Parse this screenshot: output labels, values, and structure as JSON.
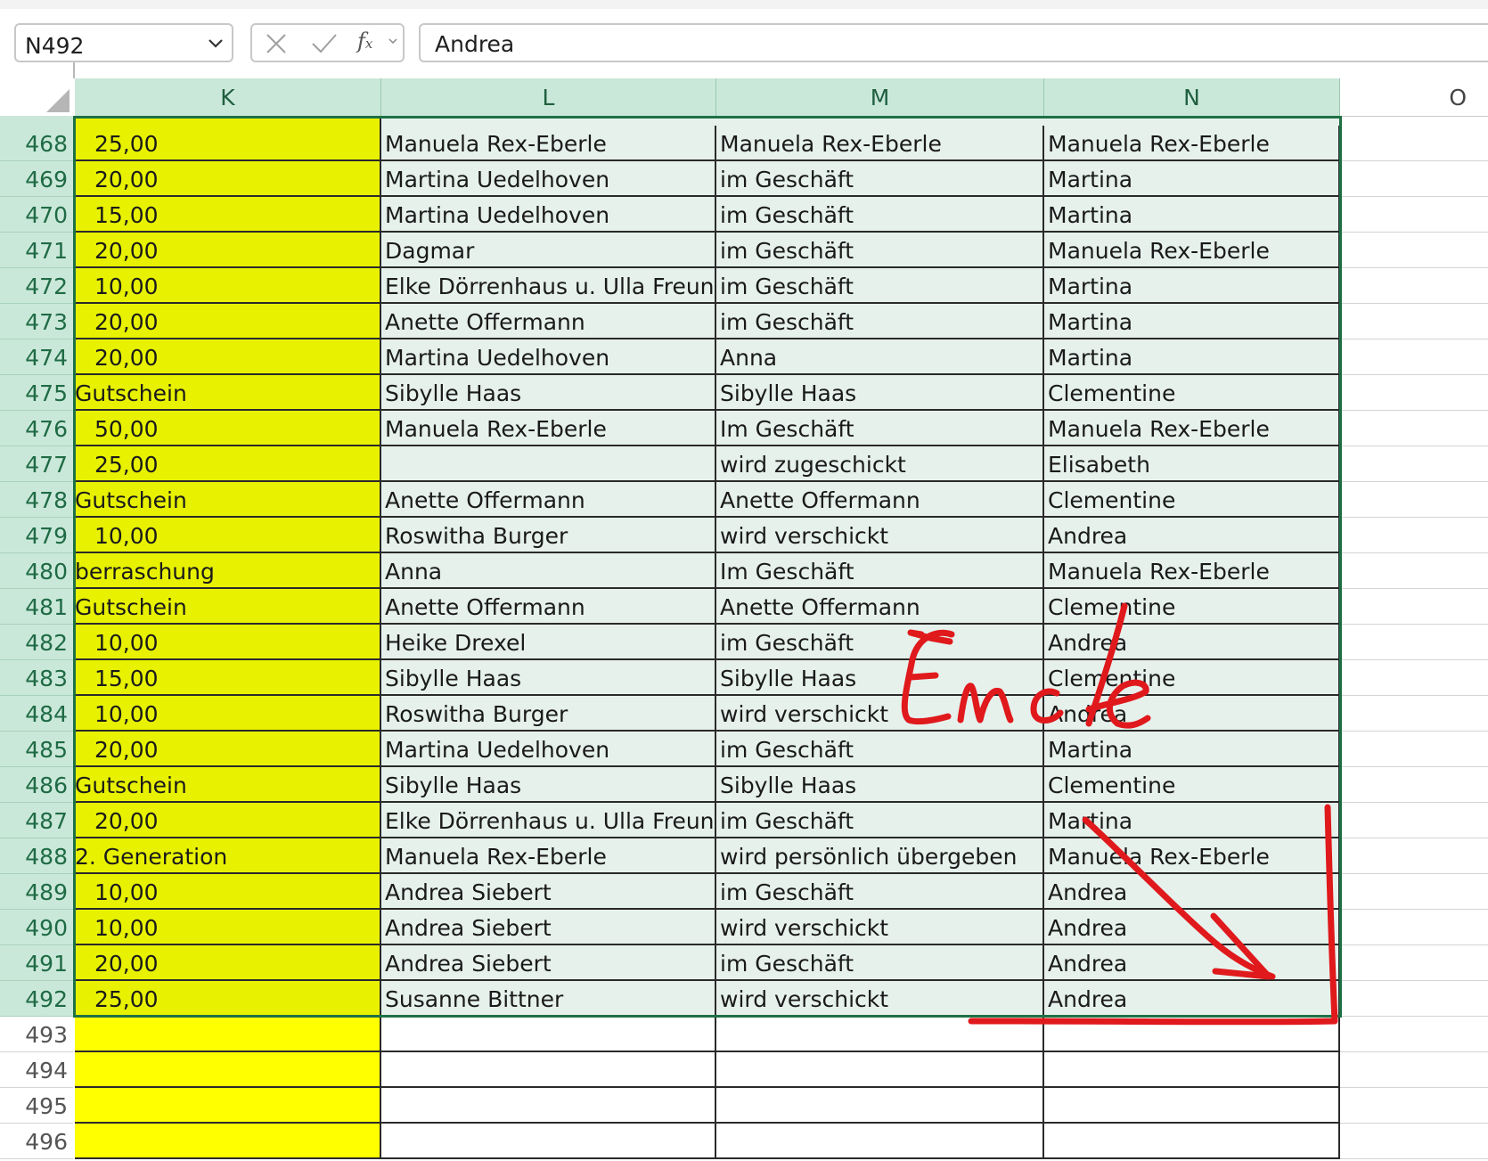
{
  "formula_bar": {
    "name_box": "N492",
    "formula_value": "Andrea",
    "fx_label": "f",
    "fx_sub": "x"
  },
  "columns": [
    {
      "letter": "K",
      "selected": true
    },
    {
      "letter": "L",
      "selected": true
    },
    {
      "letter": "M",
      "selected": true
    },
    {
      "letter": "N",
      "selected": true
    },
    {
      "letter": "O",
      "selected": false
    }
  ],
  "rows": [
    {
      "num": "468",
      "k": "25,00",
      "k_type": "num",
      "l": "Manuela Rex-Eberle",
      "m": "Manuela Rex-Eberle",
      "n": "Manuela Rex-Eberle"
    },
    {
      "num": "469",
      "k": "20,00",
      "k_type": "num",
      "l": "Martina Uedelhoven",
      "m": "im Geschäft",
      "n": "Martina"
    },
    {
      "num": "470",
      "k": "15,00",
      "k_type": "num",
      "l": "Martina Uedelhoven",
      "m": "im Geschäft",
      "n": "Martina"
    },
    {
      "num": "471",
      "k": "20,00",
      "k_type": "num",
      "l": "Dagmar",
      "m": "im Geschäft",
      "n": "Manuela Rex-Eberle"
    },
    {
      "num": "472",
      "k": "10,00",
      "k_type": "num",
      "l": "Elke Dörrenhaus u. Ulla Freund",
      "m": "im Geschäft",
      "n": "Martina"
    },
    {
      "num": "473",
      "k": "20,00",
      "k_type": "num",
      "l": "Anette Offermann",
      "m": "im Geschäft",
      "n": "Martina"
    },
    {
      "num": "474",
      "k": "20,00",
      "k_type": "num",
      "l": "Martina Uedelhoven",
      "m": "Anna",
      "n": "Martina"
    },
    {
      "num": "475",
      "k": "Gutschein",
      "k_type": "txt",
      "l": "Sibylle Haas",
      "m": "Sibylle Haas",
      "n": "Clementine"
    },
    {
      "num": "476",
      "k": "50,00",
      "k_type": "num",
      "l": "Manuela Rex-Eberle",
      "m": "Im Geschäft",
      "n": "Manuela Rex-Eberle"
    },
    {
      "num": "477",
      "k": "25,00",
      "k_type": "num",
      "l": "",
      "m": "wird zugeschickt",
      "n": "Elisabeth"
    },
    {
      "num": "478",
      "k": "Gutschein",
      "k_type": "txt",
      "l": "Anette Offermann",
      "m": "Anette Offermann",
      "n": "Clementine"
    },
    {
      "num": "479",
      "k": "10,00",
      "k_type": "num",
      "l": "Roswitha Burger",
      "m": "wird verschickt",
      "n": "Andrea"
    },
    {
      "num": "480",
      "k": "berraschung",
      "k_type": "txt",
      "l": "Anna",
      "m": "Im Geschäft",
      "n": "Manuela Rex-Eberle"
    },
    {
      "num": "481",
      "k": "Gutschein",
      "k_type": "txt",
      "l": "Anette Offermann",
      "m": "Anette Offermann",
      "n": "Clementine"
    },
    {
      "num": "482",
      "k": "10,00",
      "k_type": "num",
      "l": "Heike Drexel",
      "m": "im Geschäft",
      "n": "Andrea"
    },
    {
      "num": "483",
      "k": "15,00",
      "k_type": "num",
      "l": "Sibylle Haas",
      "m": "Sibylle Haas",
      "n": "Clementine"
    },
    {
      "num": "484",
      "k": "10,00",
      "k_type": "num",
      "l": "Roswitha Burger",
      "m": "wird verschickt",
      "n": "Andrea"
    },
    {
      "num": "485",
      "k": "20,00",
      "k_type": "num",
      "l": "Martina Uedelhoven",
      "m": "im Geschäft",
      "n": "Martina"
    },
    {
      "num": "486",
      "k": "Gutschein",
      "k_type": "txt",
      "l": "Sibylle Haas",
      "m": "Sibylle Haas",
      "n": "Clementine"
    },
    {
      "num": "487",
      "k": "20,00",
      "k_type": "num",
      "l": "Elke Dörrenhaus u. Ulla Freund",
      "m": "im Geschäft",
      "n": "Martina"
    },
    {
      "num": "488",
      "k": "2. Generation",
      "k_type": "txt",
      "l": "Manuela Rex-Eberle",
      "m": "wird persönlich übergeben",
      "n": "Manuela Rex-Eberle"
    },
    {
      "num": "489",
      "k": "10,00",
      "k_type": "num",
      "l": "Andrea Siebert",
      "m": "im Geschäft",
      "n": "Andrea"
    },
    {
      "num": "490",
      "k": "10,00",
      "k_type": "num",
      "l": "Andrea Siebert",
      "m": "wird verschickt",
      "n": "Andrea"
    },
    {
      "num": "491",
      "k": "20,00",
      "k_type": "num",
      "l": "Andrea Siebert",
      "m": "im Geschäft",
      "n": "Andrea"
    },
    {
      "num": "492",
      "k": "25,00",
      "k_type": "num",
      "l": "Susanne Bittner",
      "m": "wird verschickt",
      "n": "Andrea"
    },
    {
      "num": "493",
      "k": "",
      "k_type": "num",
      "l": "",
      "m": "",
      "n": ""
    },
    {
      "num": "494",
      "k": "",
      "k_type": "num",
      "l": "",
      "m": "",
      "n": ""
    },
    {
      "num": "495",
      "k": "",
      "k_type": "num",
      "l": "",
      "m": "",
      "n": ""
    },
    {
      "num": "496",
      "k": "",
      "k_type": "num",
      "l": "",
      "m": "",
      "n": ""
    }
  ],
  "selection": {
    "first_row": "468",
    "last_row": "492",
    "first_col": "K",
    "last_col": "N"
  },
  "annotation": {
    "text": "Ende",
    "color": "#e0191c"
  },
  "colors": {
    "selection_border": "#1e7145",
    "header_selected": "#cae8d9",
    "yellow_fill": "#ffff00"
  }
}
